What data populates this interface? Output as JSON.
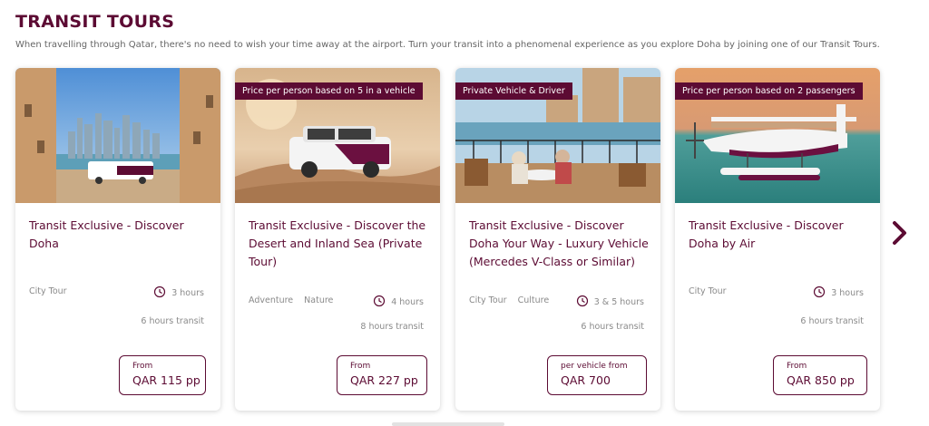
{
  "section": {
    "title": "TRANSIT TOURS",
    "subtitle": "When travelling through Qatar, there's no need to wish your time away at the airport. Turn your transit into a phenomenal experience as you explore Doha by joining one of our Transit Tours."
  },
  "colors": {
    "brand": "#5c0b33",
    "muted_text": "#8a8a8a"
  },
  "cards": [
    {
      "badge": "",
      "title": "Transit Exclusive - Discover Doha",
      "tags": [
        "City Tour"
      ],
      "duration": "3 hours",
      "transit": "6 hours transit",
      "price_prefix": "From",
      "price": "QAR 115 pp",
      "image": "doha-skyline-bus-photo"
    },
    {
      "badge": "Price per person based on 5 in a vehicle",
      "title": "Transit Exclusive - Discover the Desert and Inland Sea (Private Tour)",
      "tags": [
        "Adventure",
        "Nature"
      ],
      "duration": "4 hours",
      "transit": "8 hours transit",
      "price_prefix": "From",
      "price": "QAR 227 pp",
      "image": "desert-suv-photo"
    },
    {
      "badge": "Private Vehicle & Driver",
      "title": "Transit Exclusive - Discover Doha Your Way - Luxury Vehicle (Mercedes V-Class or Similar)",
      "tags": [
        "City Tour",
        "Culture"
      ],
      "duration": "3 & 5 hours",
      "transit": "6 hours transit",
      "price_prefix": "per vehicle from",
      "price": "QAR 700",
      "image": "waterfront-cafe-photo"
    },
    {
      "badge": "Price per person based on 2 passengers",
      "title": "Transit Exclusive - Discover Doha by Air",
      "tags": [
        "City Tour"
      ],
      "duration": "3 hours",
      "transit": "6 hours transit",
      "price_prefix": "From",
      "price": "QAR 850 pp",
      "image": "seaplane-photo"
    }
  ],
  "navigation": {
    "next_icon": "chevron-right-icon"
  }
}
